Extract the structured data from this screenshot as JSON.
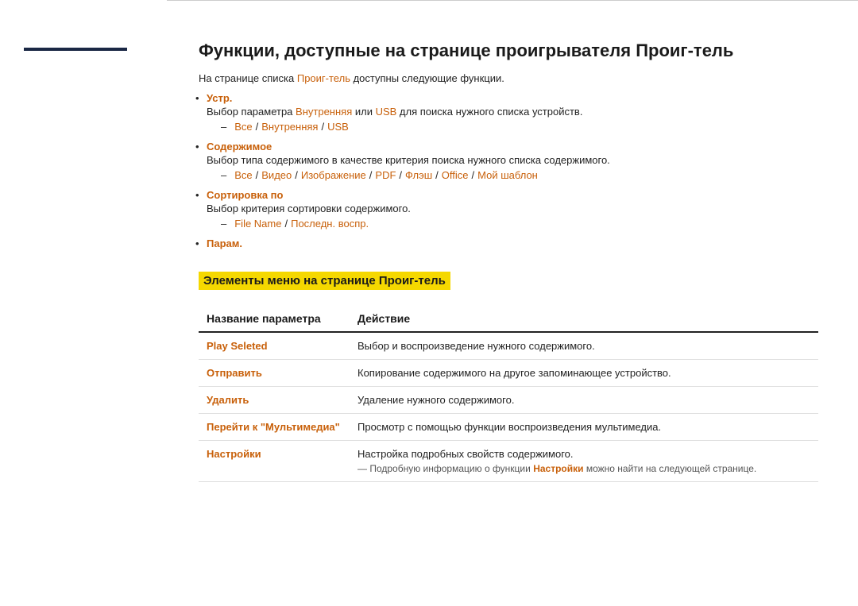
{
  "sidebar": {
    "accent_color": "#1a2744"
  },
  "page": {
    "title": "Функции, доступные на странице проигрывателя Проиг-тель",
    "intro": "На странице списка",
    "intro_link": "Проиг-тель",
    "intro_suffix": "доступны следующие функции.",
    "bullets": [
      {
        "title": "Устр.",
        "desc": "Выбор параметра",
        "desc_link1": "Внутренняя",
        "desc_mid": "или",
        "desc_link2": "USB",
        "desc_suffix": "для поиска нужного списка устройств.",
        "sub_items": [
          {
            "parts": [
              {
                "text": "Все",
                "is_link": true
              },
              {
                "text": " / ",
                "is_link": false
              },
              {
                "text": "Внутренняя",
                "is_link": true
              },
              {
                "text": " / ",
                "is_link": false
              },
              {
                "text": "USB",
                "is_link": true
              }
            ]
          }
        ]
      },
      {
        "title": "Содержимое",
        "desc": "Выбор типа содержимого в качестве критерия поиска нужного списка содержимого.",
        "sub_items": [
          {
            "parts": [
              {
                "text": "Все",
                "is_link": true
              },
              {
                "text": " / ",
                "is_link": false
              },
              {
                "text": "Видео",
                "is_link": true
              },
              {
                "text": " / ",
                "is_link": false
              },
              {
                "text": "Изображение",
                "is_link": true
              },
              {
                "text": " / ",
                "is_link": false
              },
              {
                "text": "PDF",
                "is_link": true
              },
              {
                "text": " / ",
                "is_link": false
              },
              {
                "text": "Флэш",
                "is_link": true
              },
              {
                "text": " / ",
                "is_link": false
              },
              {
                "text": "Office",
                "is_link": true
              },
              {
                "text": " / ",
                "is_link": false
              },
              {
                "text": "Мой шаблон",
                "is_link": true
              }
            ]
          }
        ]
      },
      {
        "title": "Сортировка по",
        "desc": "Выбор критерия сортировки содержимого.",
        "sub_items": [
          {
            "parts": [
              {
                "text": "File Name",
                "is_link": true
              },
              {
                "text": " / ",
                "is_link": false
              },
              {
                "text": "Последн. воспр.",
                "is_link": true
              }
            ]
          }
        ]
      },
      {
        "title": "Парам.",
        "desc": "",
        "sub_items": []
      }
    ],
    "section2_heading": "Элементы меню на странице Проиг-тель",
    "table": {
      "col1": "Название параметра",
      "col2": "Действие",
      "rows": [
        {
          "param": "Play Seleted",
          "action": "Выбор и воспроизведение нужного содержимого.",
          "note": ""
        },
        {
          "param": "Отправить",
          "action": "Копирование содержимого на другое запоминающее устройство.",
          "note": ""
        },
        {
          "param": "Удалить",
          "action": "Удаление нужного содержимого.",
          "note": ""
        },
        {
          "param": "Перейти к \"Мультимедиа\"",
          "action": "Просмотр с помощью функции воспроизведения мультимедиа.",
          "note": ""
        },
        {
          "param": "Настройки",
          "action": "Настройка подробных свойств содержимого.",
          "note": "— Подробную информацию о функции Настройки можно найти на следующей странице.",
          "note_link": "Настройки"
        }
      ]
    }
  }
}
